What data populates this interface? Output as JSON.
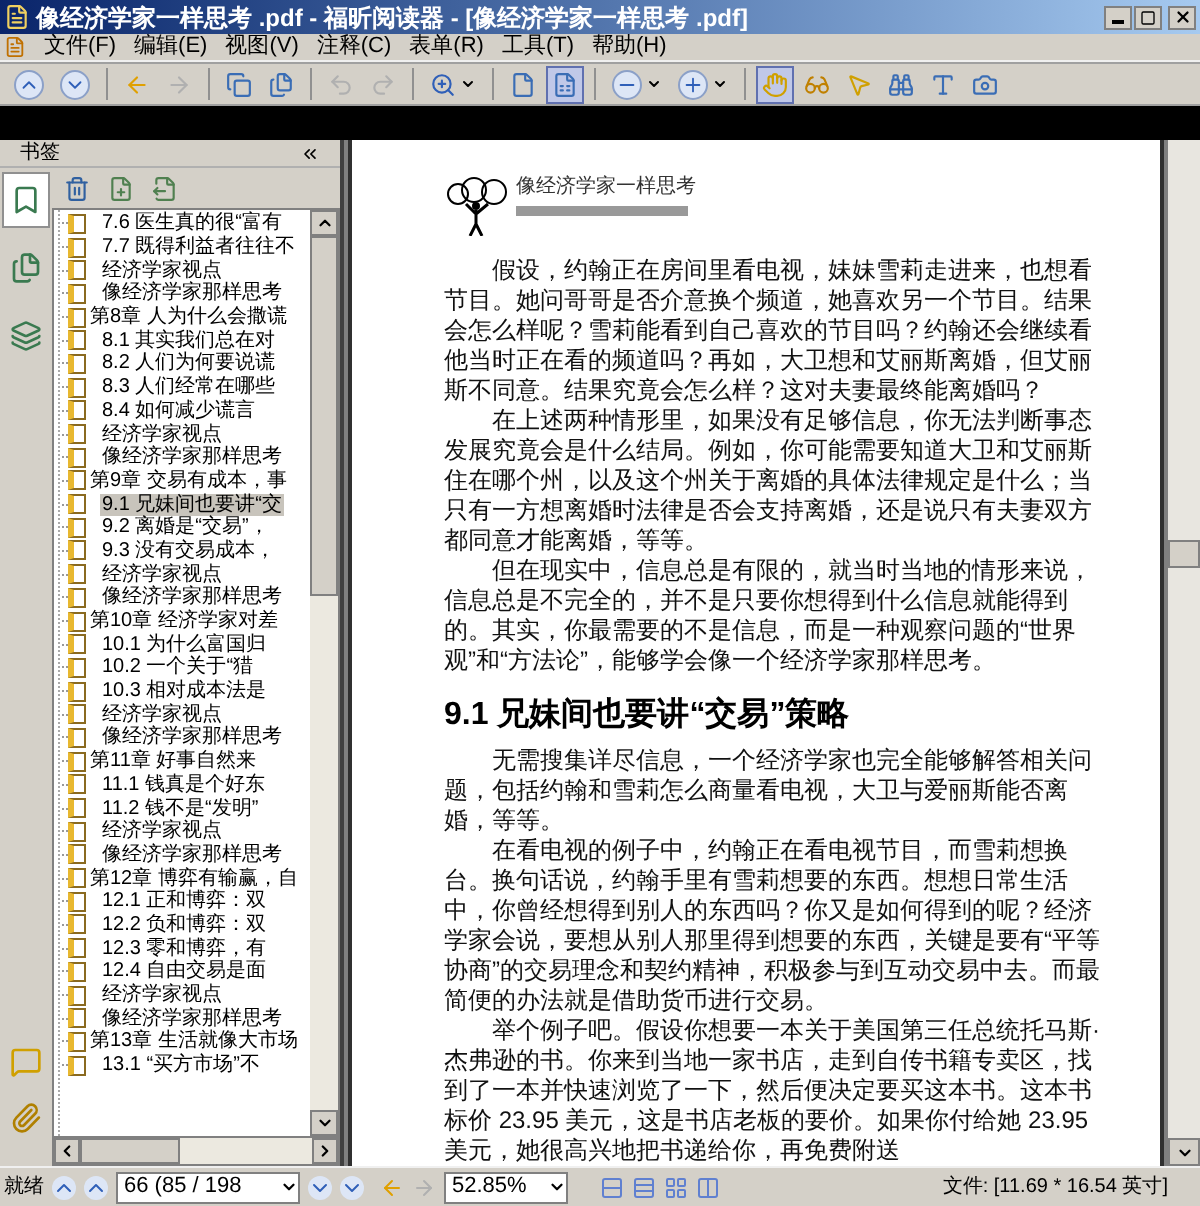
{
  "window": {
    "title": "像经济学家一样思考 .pdf - 福昕阅读器 - [像经济学家一样思考 .pdf]"
  },
  "menu": [
    "文件(F)",
    "编辑(E)",
    "视图(V)",
    "注释(C)",
    "表单(R)",
    "工具(T)",
    "帮助(H)"
  ],
  "toolbar": [
    {
      "disabled": false,
      "selected": false
    },
    {
      "disabled": false,
      "selected": false
    },
    {
      "disabled": false,
      "selected": false
    },
    {
      "disabled": true,
      "selected": false
    },
    {
      "disabled": false,
      "selected": false
    },
    {
      "disabled": false,
      "selected": false
    },
    {
      "disabled": true,
      "selected": false
    },
    {
      "disabled": true,
      "selected": false
    },
    {
      "disabled": false,
      "selected": false
    },
    {
      "disabled": false,
      "selected": false
    },
    {
      "disabled": false,
      "selected": true
    },
    {
      "disabled": false,
      "selected": false
    },
    {
      "disabled": false,
      "selected": false
    },
    {
      "disabled": false,
      "selected": true
    },
    {
      "disabled": false,
      "selected": false
    },
    {
      "disabled": false,
      "selected": false
    },
    {
      "disabled": false,
      "selected": false
    },
    {
      "disabled": false,
      "selected": false
    },
    {
      "disabled": false,
      "selected": false
    }
  ],
  "panel_tabs": [
    {
      "selected": true
    },
    {
      "selected": false
    },
    {
      "selected": false
    }
  ],
  "bookmarks": {
    "title": "书签",
    "continued": [
      {
        "label": "7.6 医生真的很“富有",
        "selected": false
      },
      {
        "label": "7.7 既得利益者往往不",
        "selected": false
      },
      {
        "label": "经济学家视点",
        "selected": false
      },
      {
        "label": "像经济学家那样思考",
        "selected": false
      }
    ],
    "chapters": [
      {
        "label": "第8章 人为什么会撒谎",
        "selected": false,
        "children": [
          {
            "label": "8.1 其实我们总在对",
            "selected": false
          },
          {
            "label": "8.2 人们为何要说谎",
            "selected": false
          },
          {
            "label": "8.3 人们经常在哪些",
            "selected": false
          },
          {
            "label": "8.4 如何减少谎言",
            "selected": false
          },
          {
            "label": "经济学家视点",
            "selected": false
          },
          {
            "label": "像经济学家那样思考",
            "selected": false
          }
        ]
      },
      {
        "label": "第9章 交易有成本，事",
        "selected": false,
        "children": [
          {
            "label": "9.1 兄妹间也要讲“交",
            "selected": true
          },
          {
            "label": "9.2 离婚是“交易”，",
            "selected": false
          },
          {
            "label": "9.3 没有交易成本，",
            "selected": false
          },
          {
            "label": "经济学家视点",
            "selected": false
          },
          {
            "label": "像经济学家那样思考",
            "selected": false
          }
        ]
      },
      {
        "label": "第10章 经济学家对差",
        "selected": false,
        "children": [
          {
            "label": "10.1 为什么富国归",
            "selected": false
          },
          {
            "label": "10.2 一个关于“猎",
            "selected": false
          },
          {
            "label": "10.3 相对成本法是",
            "selected": false
          },
          {
            "label": "经济学家视点",
            "selected": false
          },
          {
            "label": "像经济学家那样思考",
            "selected": false
          }
        ]
      },
      {
        "label": "第11章 好事自然来",
        "selected": false,
        "children": [
          {
            "label": "11.1 钱真是个好东",
            "selected": false
          },
          {
            "label": "11.2 钱不是“发明”",
            "selected": false
          },
          {
            "label": "经济学家视点",
            "selected": false
          },
          {
            "label": "像经济学家那样思考",
            "selected": false
          }
        ]
      },
      {
        "label": "第12章 博弈有输赢，自",
        "selected": false,
        "children": [
          {
            "label": "12.1 正和博弈：双",
            "selected": false
          },
          {
            "label": "12.2 负和博弈：双",
            "selected": false
          },
          {
            "label": "12.3 零和博弈，有",
            "selected": false
          },
          {
            "label": "12.4 自由交易是面",
            "selected": false
          },
          {
            "label": "经济学家视点",
            "selected": false
          },
          {
            "label": "像经济学家那样思考",
            "selected": false
          }
        ]
      },
      {
        "label": "第13章 生活就像大市场",
        "selected": false,
        "children": [
          {
            "label": "13.1 “买方市场”不",
            "selected": false
          }
        ]
      }
    ]
  },
  "document": {
    "running_head": "像经济学家一样思考",
    "blocks": [
      {
        "kind": "body",
        "text": "假设，约翰正在房间里看电视，妹妹雪莉走进来，也想看节目。她问哥哥是否介意换个频道，她喜欢另一个节目。结果会怎么样呢？雪莉能看到自己喜欢的节目吗？约翰还会继续看他当时正在看的频道吗？再如，大卫想和艾丽斯离婚，但艾丽斯不同意。结果究竟会怎么样？这对夫妻最终能离婚吗？"
      },
      {
        "kind": "body",
        "text": "在上述两种情形里，如果没有足够信息，你无法判断事态发展究竟会是什么结局。例如，你可能需要知道大卫和艾丽斯住在哪个州，以及这个州关于离婚的具体法律规定是什么；当只有一方想离婚时法律是否会支持离婚，还是说只有夫妻双方都同意才能离婚，等等。"
      },
      {
        "kind": "body",
        "text": "但在现实中，信息总是有限的，就当时当地的情形来说，信息总是不完全的，并不是只要你想得到什么信息就能得到的。其实，你最需要的不是信息，而是一种观察问题的“世界观”和“方法论”，能够学会像一个经济学家那样思考。"
      },
      {
        "kind": "heading",
        "text": "9.1 兄妹间也要讲“交易”策略"
      },
      {
        "kind": "body",
        "text": "无需搜集详尽信息，一个经济学家也完全能够解答相关问题，包括约翰和雪莉怎么商量看电视，大卫与爱丽斯能否离婚，等等。"
      },
      {
        "kind": "body",
        "text": "在看电视的例子中，约翰正在看电视节目，而雪莉想换台。换句话说，约翰手里有雪莉想要的东西。想想日常生活中，你曾经想得到别人的东西吗？你又是如何得到的呢？经济学家会说，要想从别人那里得到想要的东西，关键是要有“平等协商”的交易理念和契约精神，积极参与到互动交易中去。而最简便的办法就是借助货币进行交易。"
      },
      {
        "kind": "body",
        "text": "举个例子吧。假设你想要一本关于美国第三任总统托马斯·杰弗逊的书。你来到当地一家书店，走到自传书籍专卖区，找到了一本并快速浏览了一下，然后便决定要买这本书。这本书标价 23.95 美元，这是书店老板的要价。如果你付给她 23.95 美元，她很高兴地把书递给你，再免费附送"
      }
    ]
  },
  "status_bar": {
    "status": "就绪",
    "page_field": "66 (85 / 198",
    "zoom_field": "52.85%",
    "page_size": "文件: [11.69 * 16.54 英寸]"
  }
}
